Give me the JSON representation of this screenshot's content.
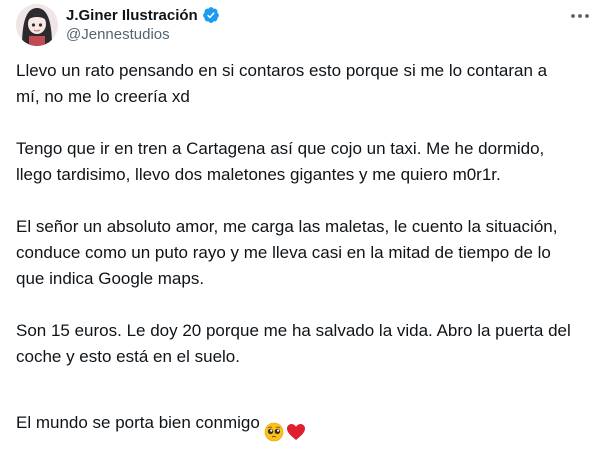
{
  "tweet": {
    "author": {
      "display_name": "J.Giner Ilustración",
      "handle": "@Jennestudios",
      "verified_icon": "verified-badge-icon",
      "verified_color": "#1d9bf0"
    },
    "more_icon": "more-horizontal-icon",
    "paragraphs": [
      "Llevo un rato pensando en si contaros esto porque si me lo contaran a\nmí, no me lo creería xd",
      "Tengo que ir en tren a Cartagena así que cojo un taxi. Me he dormido,\nllego tardisimo, llevo dos maletones gigantes y me quiero m0r1r.",
      "El señor un absoluto amor, me carga las maletas, le cuento la situación,\nconduce como un puto rayo y me lleva casi en la mitad de tiempo de lo\nque indica Google maps.",
      "Son 15 euros. Le doy 20 porque me ha salvado la vida. Abro la puerta del\ncoche y esto está en el suelo.",
      "El mundo se porta bien conmigo"
    ],
    "emojis": [
      "pleading-face-emoji",
      "red-heart-emoji"
    ]
  }
}
